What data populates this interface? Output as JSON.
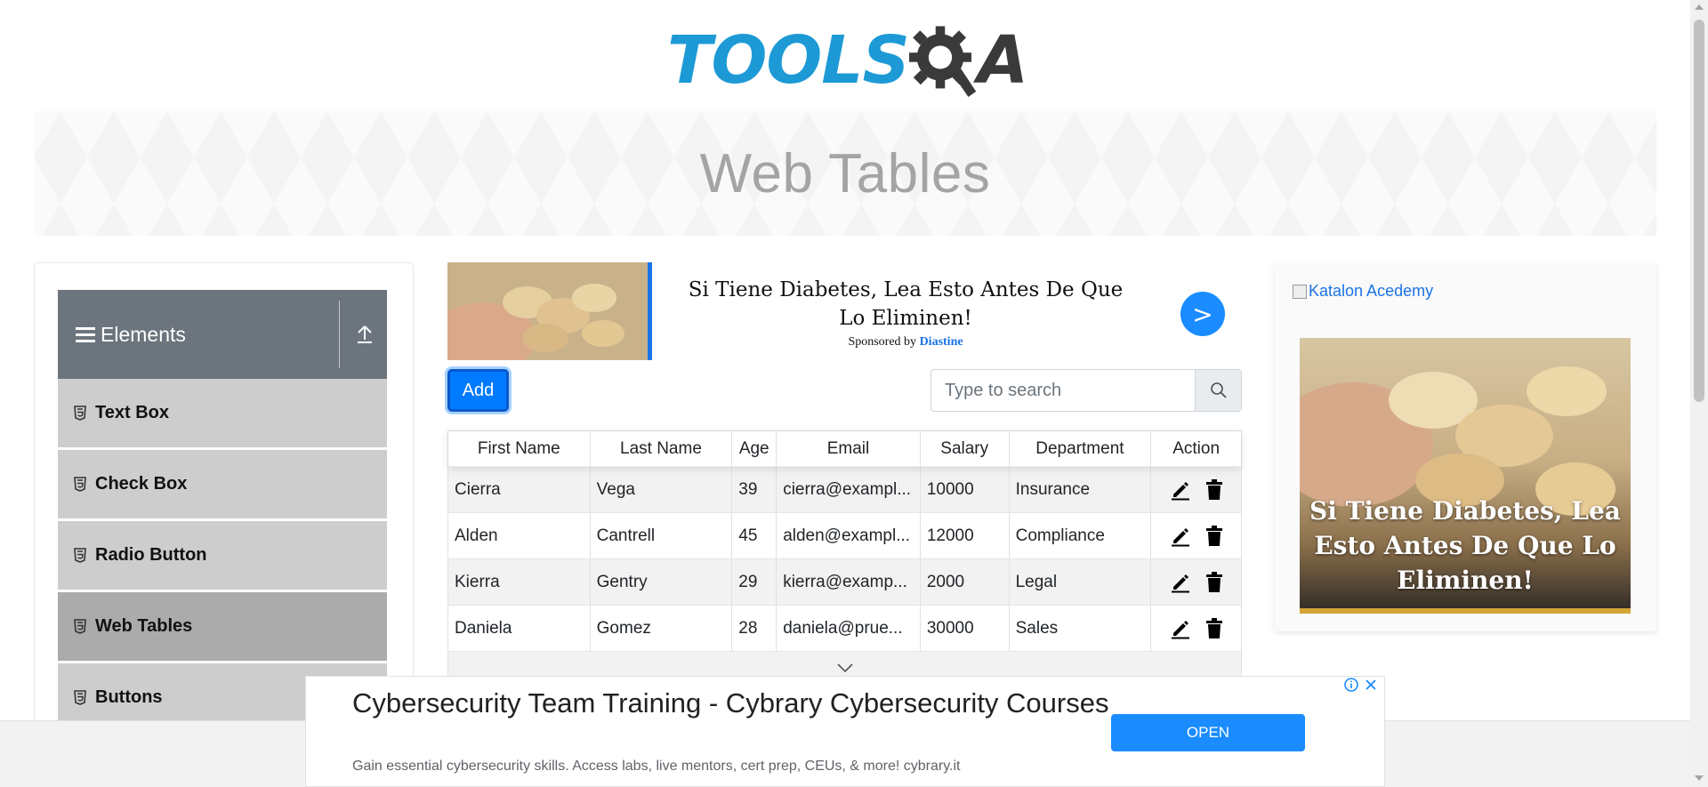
{
  "header": {
    "logo_tools": "TOOLS",
    "logo_qa": "A",
    "brand_color": "#1d9ad6",
    "logo_dark_color": "#3a3a3a"
  },
  "banner": {
    "title": "Web Tables"
  },
  "sidebar": {
    "group": {
      "label": "Elements",
      "icon": "hamburger-icon",
      "toggle_icon": "upload-arrow-icon"
    },
    "items": [
      {
        "label": "Text Box",
        "icon": "html5-icon",
        "active": false
      },
      {
        "label": "Check Box",
        "icon": "html5-icon",
        "active": false
      },
      {
        "label": "Radio Button",
        "icon": "html5-icon",
        "active": false
      },
      {
        "label": "Web Tables",
        "icon": "html5-icon",
        "active": true
      },
      {
        "label": "Buttons",
        "icon": "html5-icon",
        "active": false
      }
    ]
  },
  "ad_top": {
    "headline": "Si Tiene Diabetes, Lea Esto Antes De Que Lo Eliminen!",
    "sponsored_prefix": "Sponsored by",
    "sponsor": "Diastine",
    "go_label": ">"
  },
  "toolbar": {
    "add_label": "Add",
    "search_placeholder": "Type to search",
    "search_icon": "search-icon"
  },
  "table": {
    "columns": [
      "First Name",
      "Last Name",
      "Age",
      "Email",
      "Salary",
      "Department",
      "Action"
    ],
    "rows": [
      {
        "first": "Cierra",
        "last": "Vega",
        "age": "39",
        "email": "cierra@exampl...",
        "salary": "10000",
        "department": "Insurance"
      },
      {
        "first": "Alden",
        "last": "Cantrell",
        "age": "45",
        "email": "alden@exampl...",
        "salary": "12000",
        "department": "Compliance"
      },
      {
        "first": "Kierra",
        "last": "Gentry",
        "age": "29",
        "email": "kierra@examp...",
        "salary": "2000",
        "department": "Legal"
      },
      {
        "first": "Daniela",
        "last": "Gomez",
        "age": "28",
        "email": "daniela@prue...",
        "salary": "30000",
        "department": "Sales"
      }
    ],
    "edit_icon": "pencil-icon",
    "delete_icon": "trash-icon"
  },
  "ad_right": {
    "alt_text": "Katalon Acedemy",
    "caption": "Si Tiene Diabetes, Lea Esto Antes De Que Lo Eliminen!"
  },
  "ad_bottom": {
    "title": "Cybersecurity Team Training - Cybrary Cybersecurity Courses",
    "description": "Gain essential cybersecurity skills. Access labs, live mentors, cert prep, CEUs, & more! cybrary.it",
    "open_label": "OPEN",
    "accent": "#1a8cff"
  }
}
